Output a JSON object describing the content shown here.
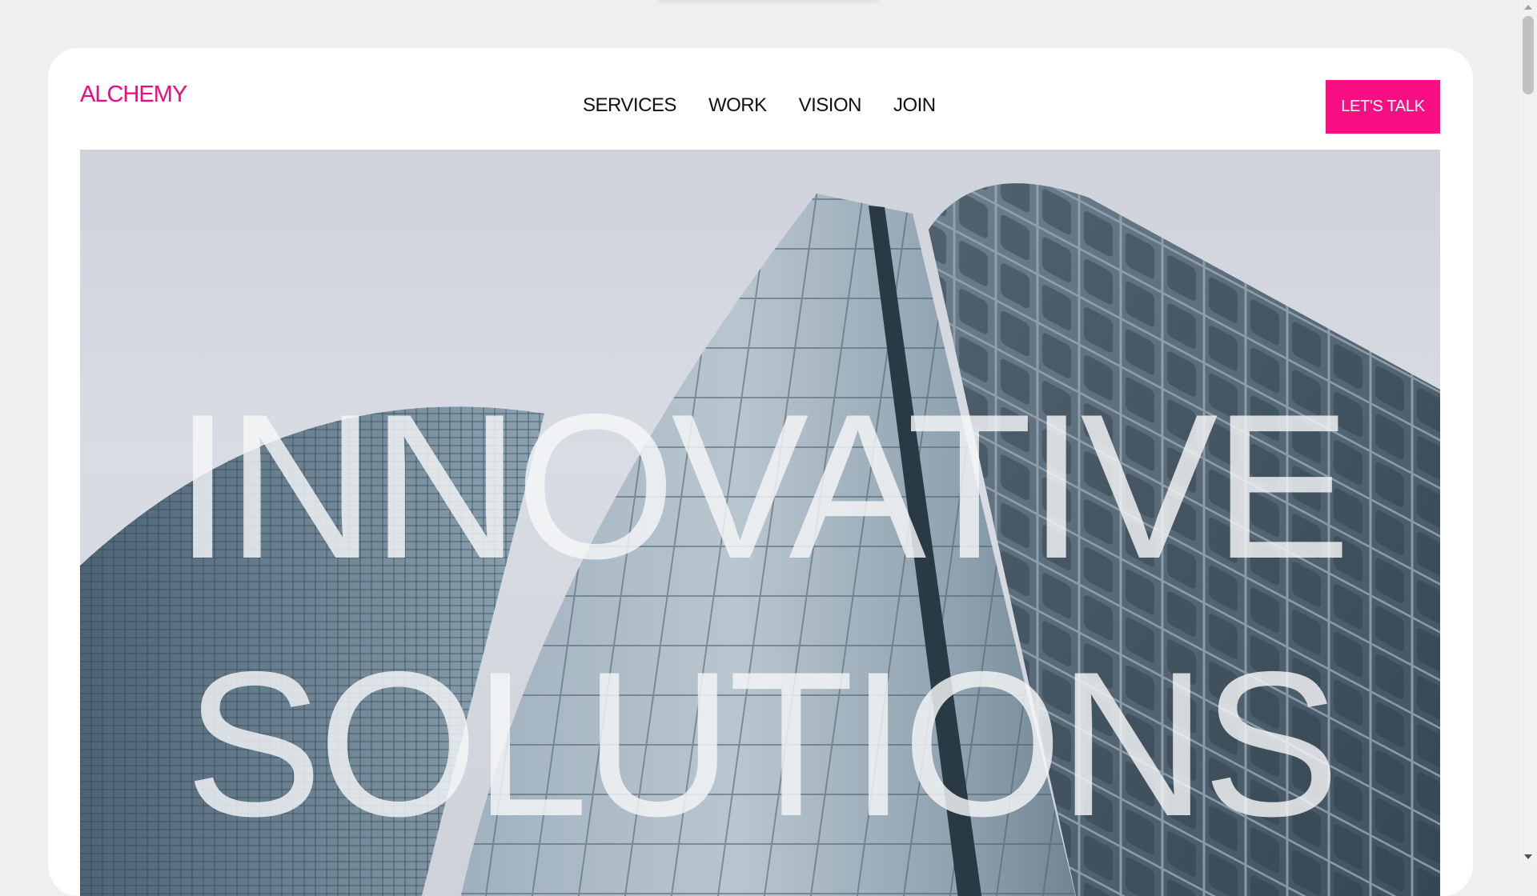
{
  "brand": {
    "name": "ALCHEMY",
    "color": "#f0097e"
  },
  "nav": {
    "items": [
      {
        "label": "SERVICES"
      },
      {
        "label": "WORK"
      },
      {
        "label": "VISION"
      },
      {
        "label": "JOIN"
      }
    ]
  },
  "cta": {
    "label": "LET'S TALK",
    "color": "#f70f83"
  },
  "hero": {
    "line1": "INNOVATIVE",
    "line2": "SOLUTIONS",
    "image_icon": "skyscraper-photo"
  }
}
